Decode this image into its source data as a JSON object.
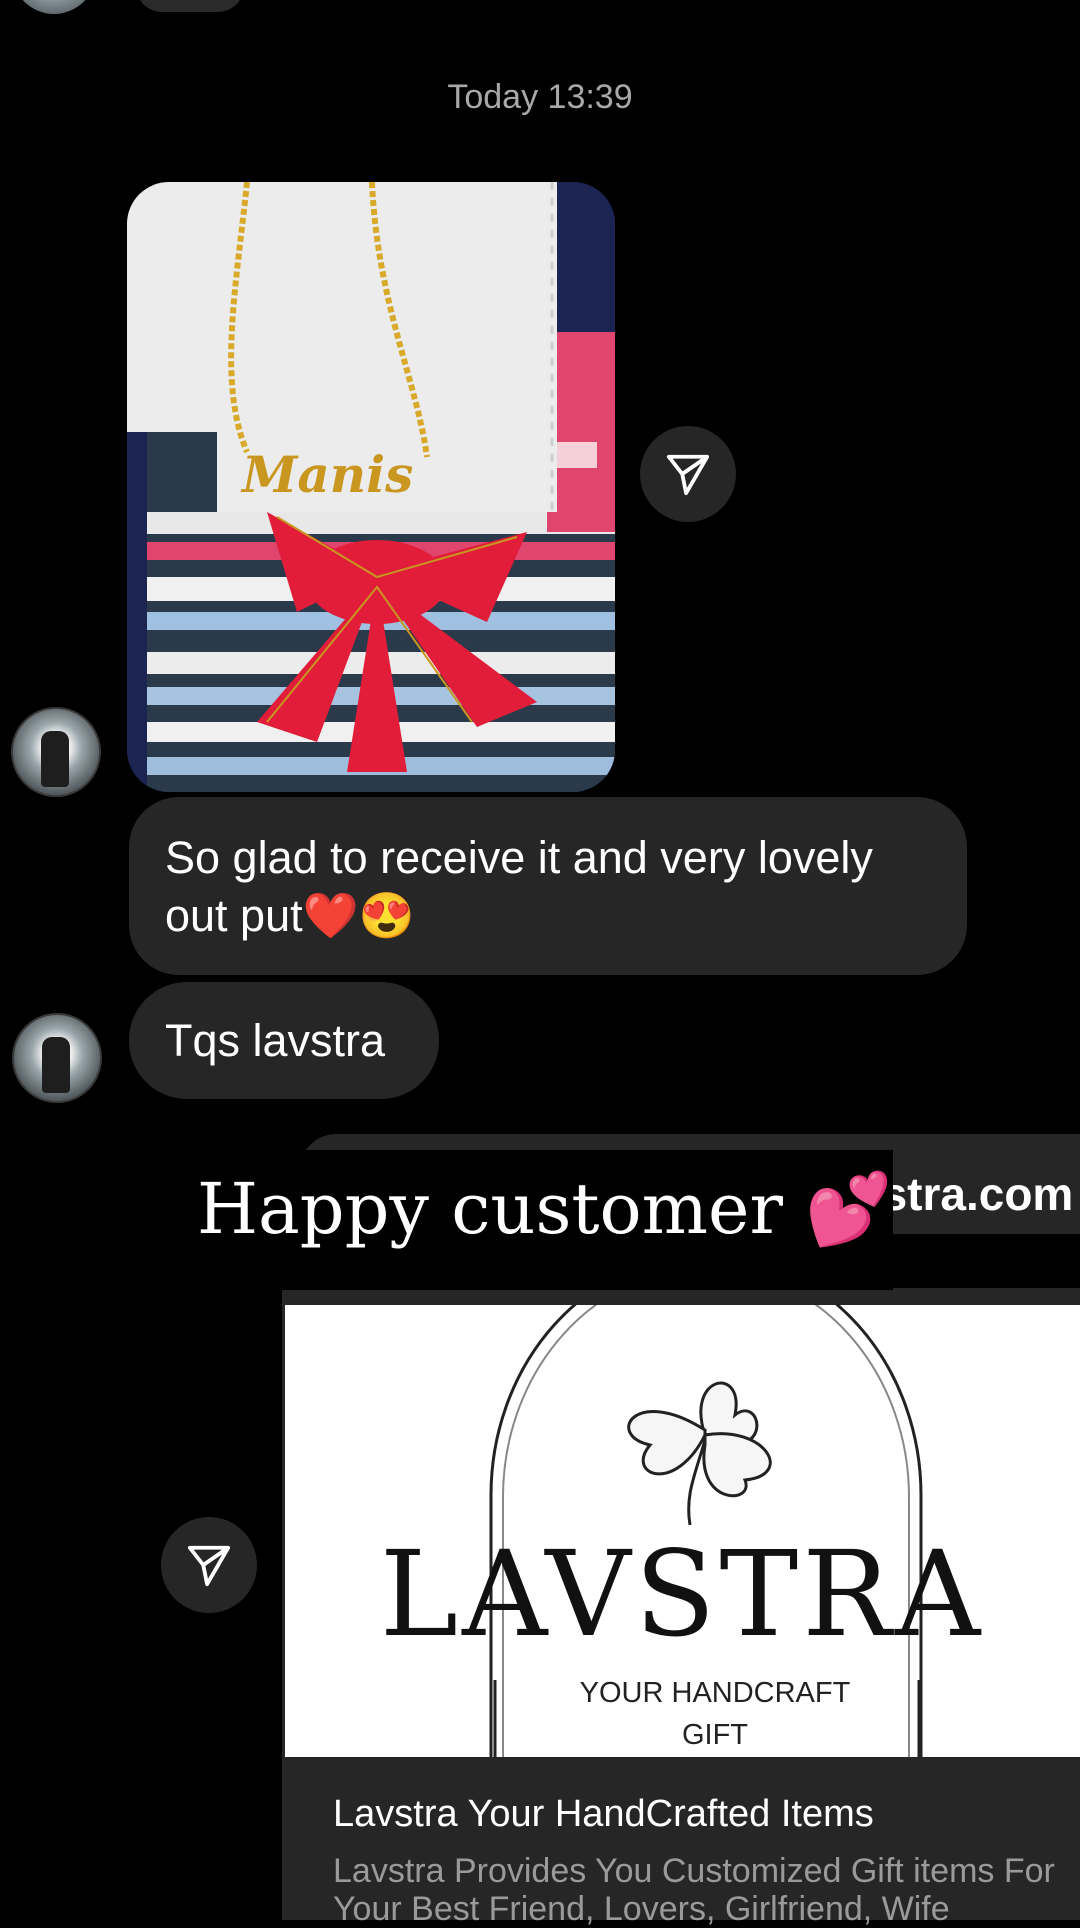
{
  "thread": {
    "timestamp": "Today 13:39"
  },
  "messages": [
    {
      "text": "So glad to receive it and very lovely out put❤️😍"
    },
    {
      "text": "Tqs lavstra"
    }
  ],
  "photo": {
    "necklace_name": "Manis"
  },
  "shared_link": {
    "domain": "vstra.com",
    "logo_brand": "LAVSTRA",
    "logo_tagline_1": "YOUR HANDCRAFT",
    "logo_tagline_2": "GIFT",
    "title": "Lavstra Your HandCrafted Items",
    "description": "Lavstra Provides You Customized Gift items For Your Best Friend, Lovers, Girlfriend, Wife"
  },
  "overlay": {
    "caption": "Happy customer 💕"
  },
  "icons": {
    "share": "paper-plane-icon",
    "heart": "red-heart-emoji",
    "heart_eyes": "heart-eyes-emoji",
    "two_hearts": "two-hearts-emoji"
  },
  "colors": {
    "background": "#000000",
    "bubble": "#262626",
    "muted_text": "#a8a8a8"
  }
}
